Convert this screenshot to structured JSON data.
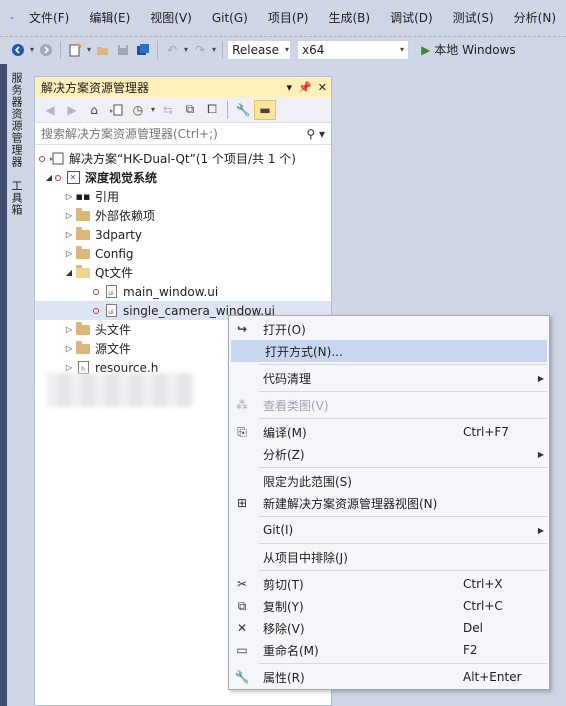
{
  "menubar": {
    "items": [
      "文件(F)",
      "编辑(E)",
      "视图(V)",
      "Git(G)",
      "项目(P)",
      "生成(B)",
      "调试(D)",
      "测试(S)",
      "分析(N)"
    ]
  },
  "toolbar": {
    "configuration": "Release",
    "platform": "x64",
    "run_label": "本地 Windows"
  },
  "side_tabs": [
    "服务器资源管理器",
    "工具箱"
  ],
  "solution_explorer": {
    "title": "解决方案资源管理器",
    "search_placeholder": "搜索解决方案资源管理器(Ctrl+;)",
    "tree": {
      "solution": "解决方案“HK-Dual-Qt”(1 个项目/共 1 个)",
      "project": "深度视觉系统",
      "references": "引用",
      "external_deps": "外部依赖项",
      "folder_3dparty": "3dparty",
      "folder_config": "Config",
      "folder_qt": "Qt文件",
      "file_main_window": "main_window.ui",
      "file_single_camera": "single_camera_window.ui",
      "folder_headers": "头文件",
      "folder_sources": "源文件",
      "file_resource": "resource.h"
    }
  },
  "context_menu": {
    "open": "打开(O)",
    "open_with": "打开方式(N)...",
    "code_cleanup": "代码清理",
    "view_class_diagram": "查看类图(V)",
    "compile": "编译(M)",
    "compile_shortcut": "Ctrl+F7",
    "analyze": "分析(Z)",
    "scope_to_this": "限定为此范围(S)",
    "new_explorer_view": "新建解决方案资源管理器视图(N)",
    "git": "Git(I)",
    "exclude_from_project": "从项目中排除(J)",
    "cut": "剪切(T)",
    "cut_shortcut": "Ctrl+X",
    "copy": "复制(Y)",
    "copy_shortcut": "Ctrl+C",
    "remove": "移除(V)",
    "remove_shortcut": "Del",
    "rename": "重命名(M)",
    "rename_shortcut": "F2",
    "properties": "属性(R)",
    "properties_shortcut": "Alt+Enter"
  }
}
